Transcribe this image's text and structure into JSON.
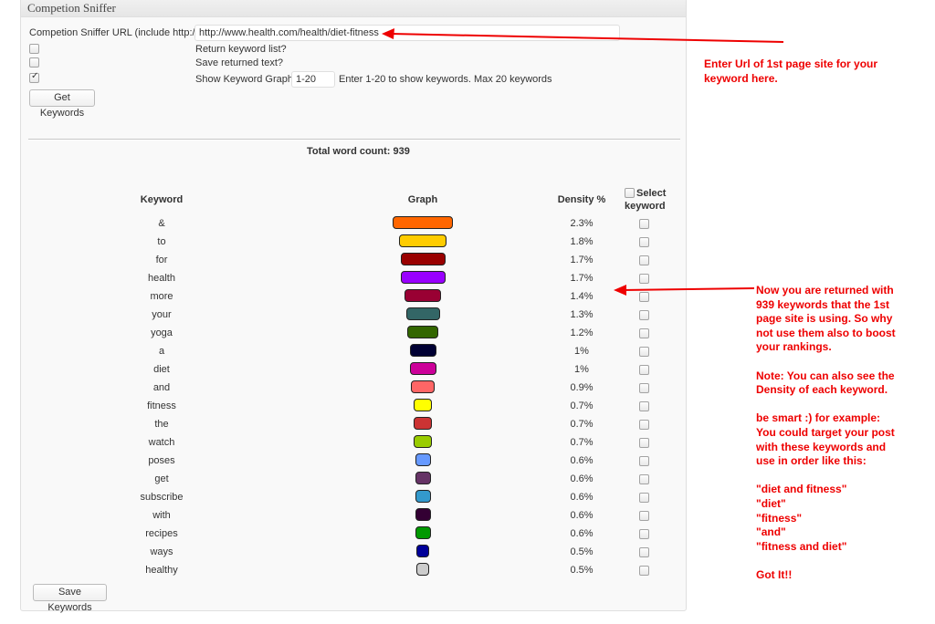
{
  "panel": {
    "title": "Competion Sniffer"
  },
  "form": {
    "url_label": "Competion Sniffer URL (include http://)",
    "url_value": "http://www.health.com/health/diet-fitness",
    "return_keyword_list_label": "Return keyword list?",
    "return_keyword_list_checked": false,
    "save_returned_text_label": "Save returned text?",
    "save_returned_text_checked": false,
    "show_keyword_graph_label": "Show Keyword Graph",
    "show_keyword_graph_checked": true,
    "graph_range_value": "1-20",
    "graph_range_hint": "Enter 1-20 to show keywords. Max 20 keywords",
    "get_keywords_button": "Get Keywords"
  },
  "results": {
    "total_word_count": "Total word count: 939",
    "headers": {
      "keyword": "Keyword",
      "graph": "Graph",
      "density": "Density %",
      "select": "Select",
      "select_line2": "keyword"
    },
    "rows": [
      {
        "keyword": "&",
        "density": "2.3%",
        "value": 2.3,
        "color": "#ff6600"
      },
      {
        "keyword": "to",
        "density": "1.8%",
        "value": 1.8,
        "color": "#ffcc00"
      },
      {
        "keyword": "for",
        "density": "1.7%",
        "value": 1.7,
        "color": "#990000"
      },
      {
        "keyword": "health",
        "density": "1.7%",
        "value": 1.7,
        "color": "#9900ff"
      },
      {
        "keyword": "more",
        "density": "1.4%",
        "value": 1.4,
        "color": "#990033"
      },
      {
        "keyword": "your",
        "density": "1.3%",
        "value": 1.3,
        "color": "#336666"
      },
      {
        "keyword": "yoga",
        "density": "1.2%",
        "value": 1.2,
        "color": "#336600"
      },
      {
        "keyword": "a",
        "density": "1%",
        "value": 1.0,
        "color": "#000033"
      },
      {
        "keyword": "diet",
        "density": "1%",
        "value": 1.0,
        "color": "#cc0099"
      },
      {
        "keyword": "and",
        "density": "0.9%",
        "value": 0.9,
        "color": "#ff6666"
      },
      {
        "keyword": "fitness",
        "density": "0.7%",
        "value": 0.7,
        "color": "#ffff00"
      },
      {
        "keyword": "the",
        "density": "0.7%",
        "value": 0.7,
        "color": "#cc3333"
      },
      {
        "keyword": "watch",
        "density": "0.7%",
        "value": 0.7,
        "color": "#99cc00"
      },
      {
        "keyword": "poses",
        "density": "0.6%",
        "value": 0.6,
        "color": "#6699ff"
      },
      {
        "keyword": "get",
        "density": "0.6%",
        "value": 0.6,
        "color": "#663366"
      },
      {
        "keyword": "subscribe",
        "density": "0.6%",
        "value": 0.6,
        "color": "#3399cc"
      },
      {
        "keyword": "with",
        "density": "0.6%",
        "value": 0.6,
        "color": "#330033"
      },
      {
        "keyword": "recipes",
        "density": "0.6%",
        "value": 0.6,
        "color": "#009900"
      },
      {
        "keyword": "ways",
        "density": "0.5%",
        "value": 0.5,
        "color": "#000099"
      },
      {
        "keyword": "healthy",
        "density": "0.5%",
        "value": 0.5,
        "color": "#cccccc"
      }
    ],
    "save_keywords_button": "Save Keywords"
  },
  "annotations": {
    "note1": [
      "Enter Url of 1st page site for your",
      "keyword here."
    ],
    "note2": [
      "Now you are returned with",
      "939 keywords that the 1st",
      "page site is using. So why",
      "not use them also to boost",
      "your rankings.",
      "",
      "Note: You can also see the",
      "Density of each keyword.",
      "",
      "be smart :) for example:",
      "You could target your post",
      "with these keywords and",
      "use in order like this:",
      "",
      "\"diet and fitness\"",
      "\"diet\"",
      "\"fitness\"",
      "\"and\"",
      "\"fitness and diet\"",
      "",
      "Got It!!"
    ],
    "arrow_color": "#ee0000"
  }
}
